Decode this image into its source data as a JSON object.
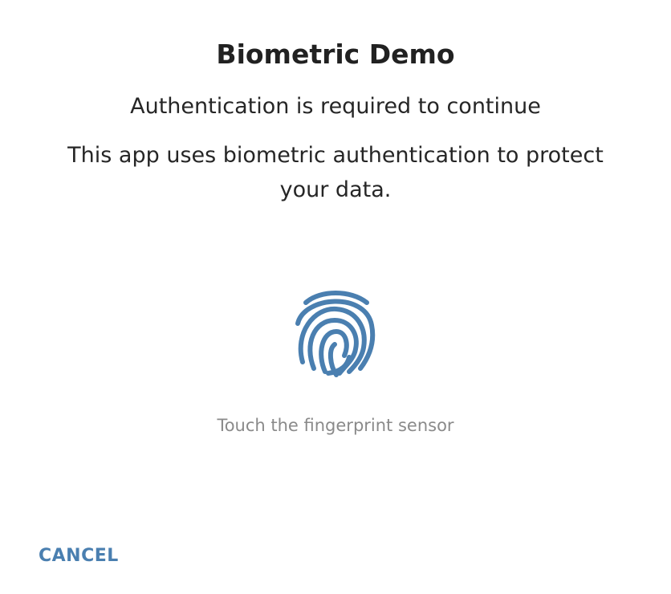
{
  "dialog": {
    "title": "Biometric Demo",
    "subtitle": "Authentication is required to continue",
    "description": "This app uses biometric authentication to protect your data.",
    "icon": "fingerprint-icon",
    "hint": "Touch the fingerprint sensor",
    "cancel_label": "CANCEL"
  },
  "colors": {
    "accent": "#4A7FB0",
    "text_primary": "#212121",
    "text_hint": "#8A8A8A",
    "background": "#FFFFFF"
  }
}
